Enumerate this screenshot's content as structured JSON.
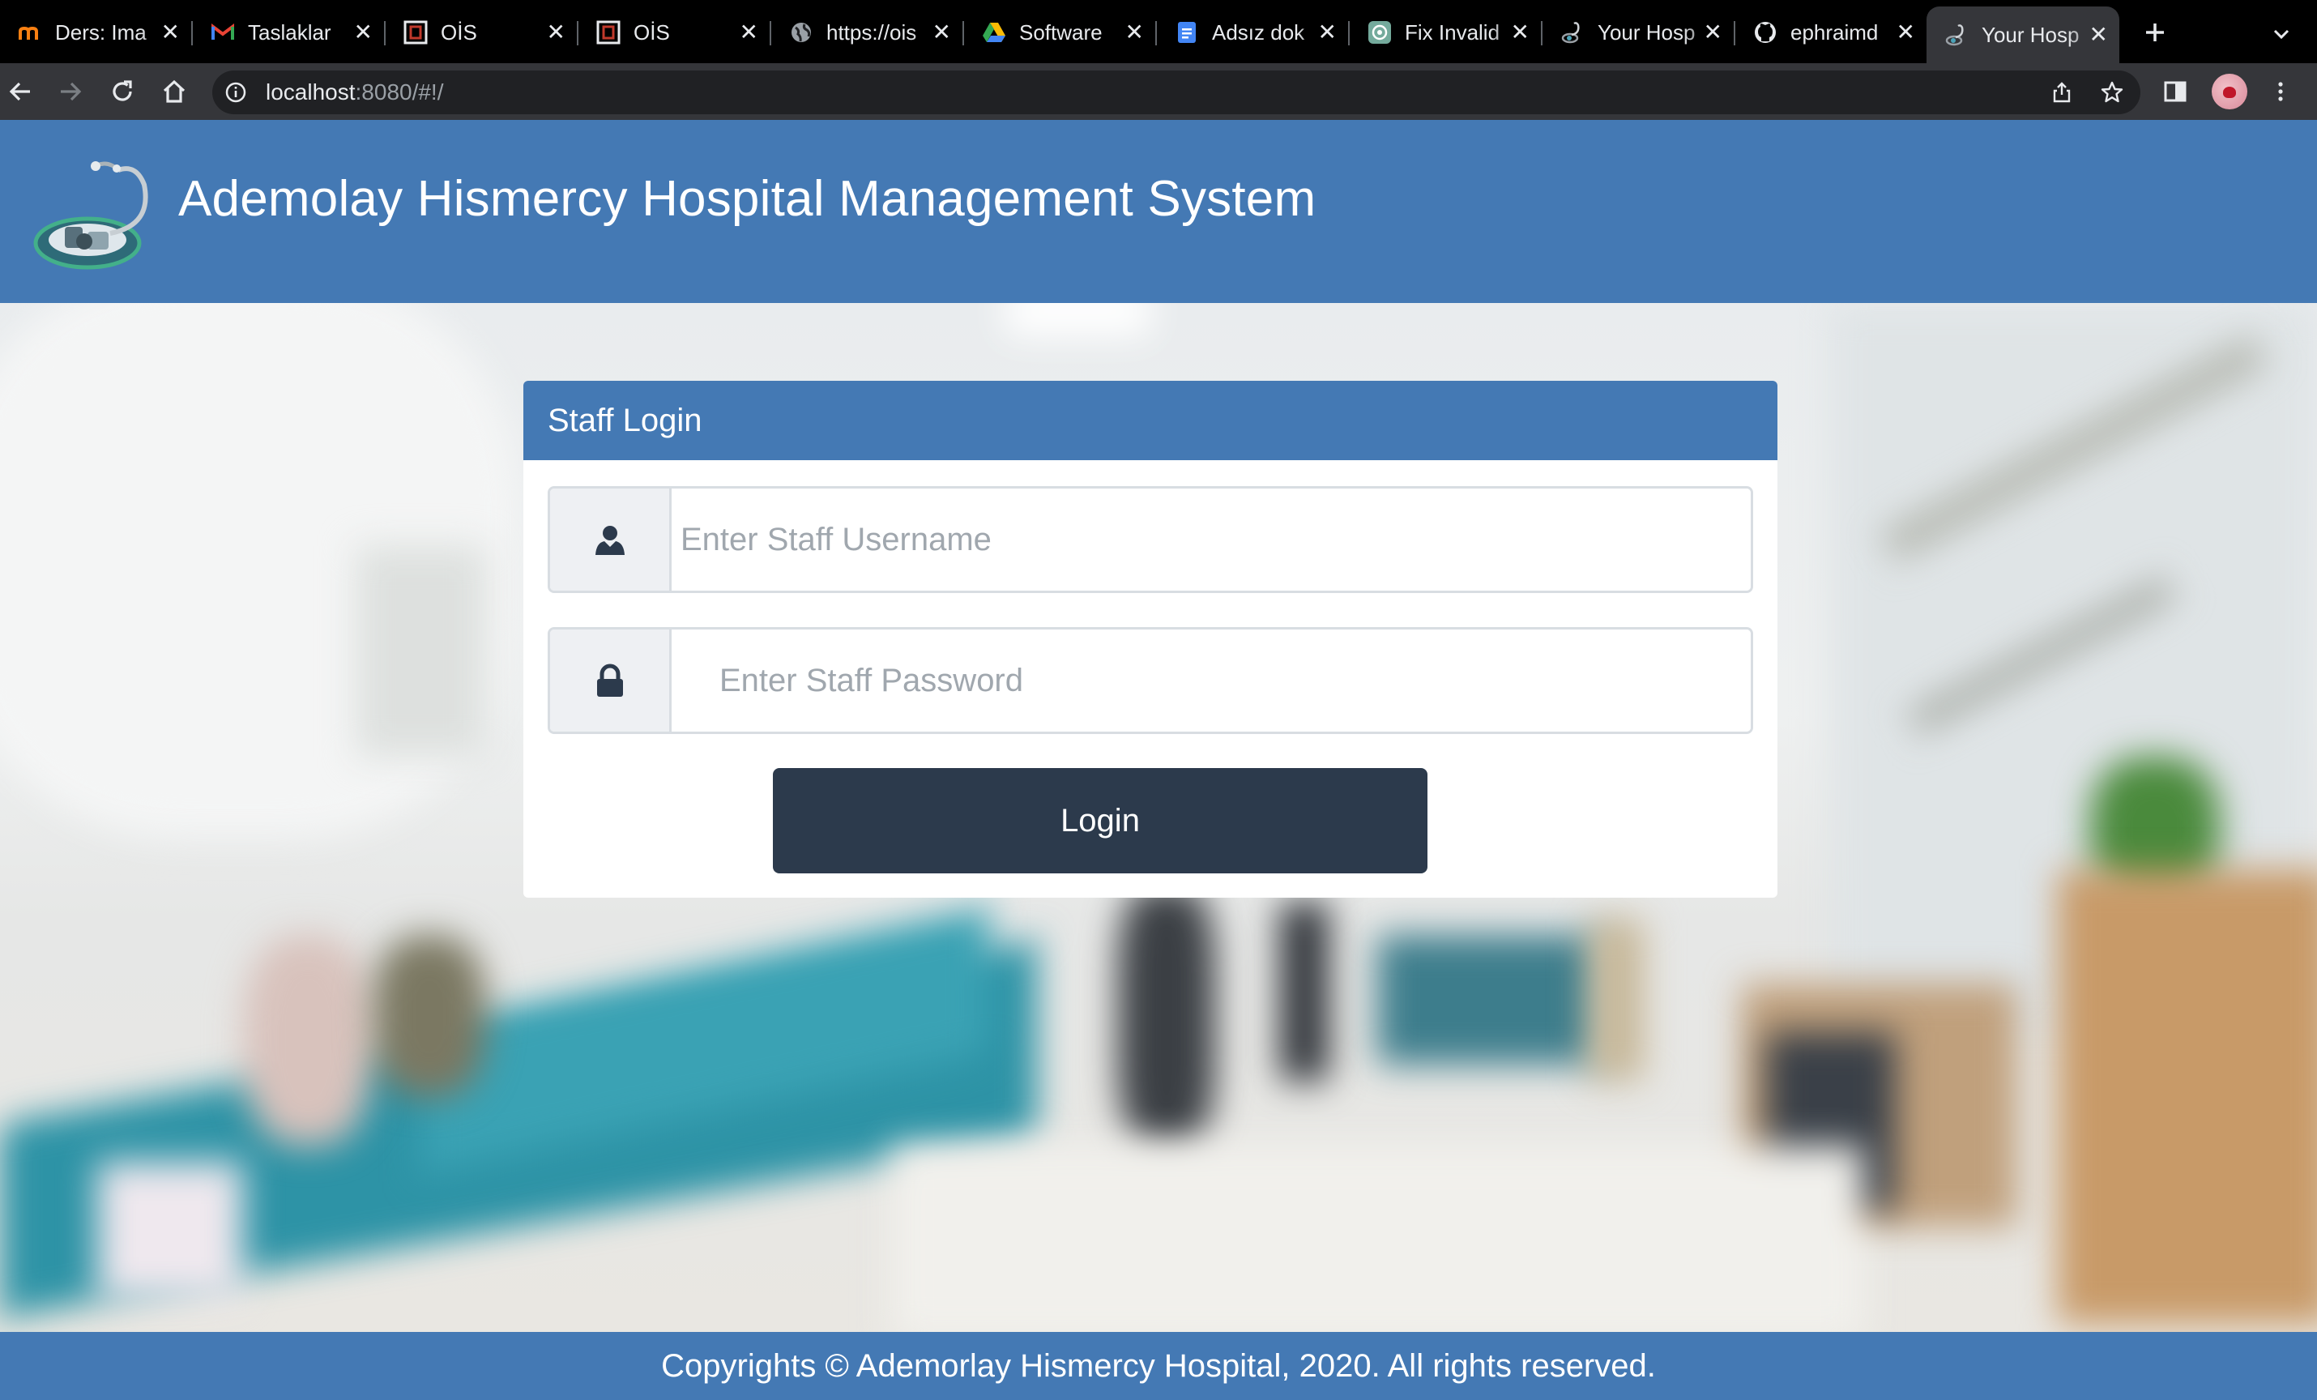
{
  "browser": {
    "tabs": [
      {
        "title": "Ders: Ima",
        "icon": "moodle-icon",
        "active": false
      },
      {
        "title": "Taslaklar",
        "icon": "gmail-icon",
        "active": false
      },
      {
        "title": "OİS",
        "icon": "ois-icon",
        "active": false
      },
      {
        "title": "OİS",
        "icon": "ois-icon",
        "active": false
      },
      {
        "title": "https://ois",
        "icon": "globe-icon",
        "active": false
      },
      {
        "title": "Software",
        "icon": "google-drive-icon",
        "active": false
      },
      {
        "title": "Adsız dok",
        "icon": "google-docs-icon",
        "active": false
      },
      {
        "title": "Fix Invalid",
        "icon": "openai-icon",
        "active": false
      },
      {
        "title": "Your Hosp",
        "icon": "stethoscope-icon",
        "active": false
      },
      {
        "title": "ephraimd",
        "icon": "github-icon",
        "active": false
      },
      {
        "title": "Your Hosp",
        "icon": "stethoscope-icon",
        "active": true
      }
    ],
    "url_host": "localhost",
    "url_rest": ":8080/#!/"
  },
  "header": {
    "title": "Ademolay Hismercy Hospital Management System"
  },
  "login": {
    "heading": "Staff Login",
    "username_placeholder": "Enter Staff Username",
    "password_placeholder": "Enter Staff Password",
    "button_label": "Login"
  },
  "footer": {
    "text": "Copyrights © Ademorlay Hismercy Hospital, 2020. All rights reserved."
  },
  "colors": {
    "header_bg": "#4479b4",
    "button_bg": "#2c3a4c",
    "browser_bg": "#000000",
    "toolbar_bg": "#35363a"
  }
}
